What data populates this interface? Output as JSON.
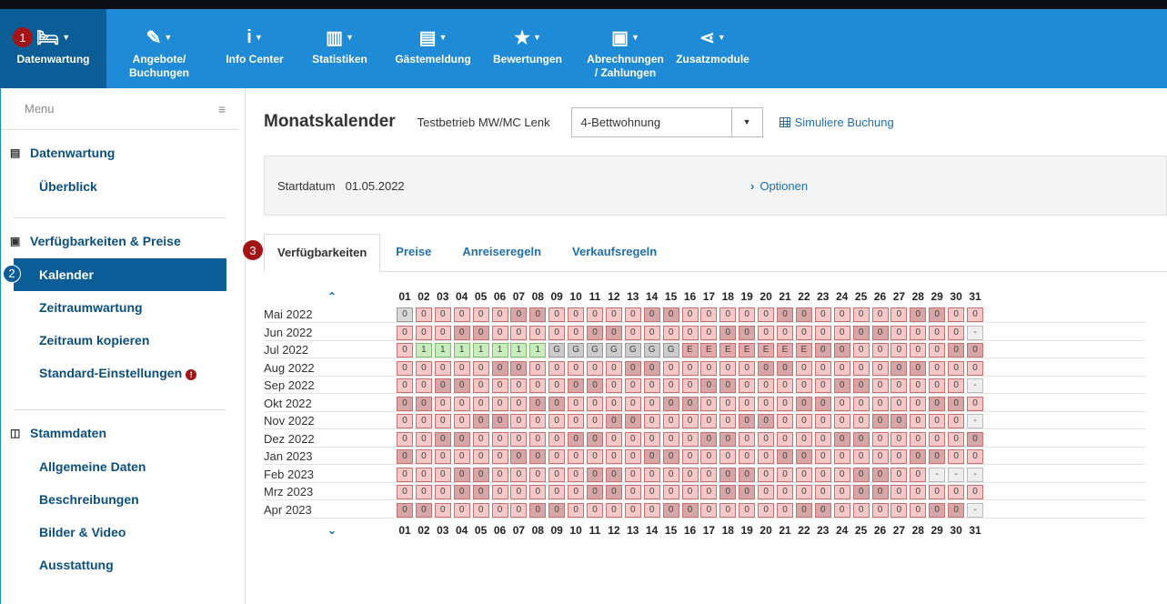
{
  "nav": {
    "items": [
      {
        "label": "Datenwartung",
        "icon": "bed-icon",
        "glyph": "🛏",
        "active": true
      },
      {
        "label": "Angebote/\nBuchungen",
        "icon": "offers-icon",
        "glyph": "✎",
        "active": false
      },
      {
        "label": "Info Center",
        "icon": "info-icon",
        "glyph": "i",
        "active": false
      },
      {
        "label": "Statistiken",
        "icon": "bar-chart-icon",
        "glyph": "▥",
        "active": false
      },
      {
        "label": "Gästemeldung",
        "icon": "document-icon",
        "glyph": "▤",
        "active": false
      },
      {
        "label": "Bewertungen",
        "icon": "star-icon",
        "glyph": "★",
        "active": false
      },
      {
        "label": "Abrechnungen\n/ Zahlungen",
        "icon": "money-icon",
        "glyph": "▣",
        "active": false
      },
      {
        "label": "Zusatzmodule",
        "icon": "share-icon",
        "glyph": "⋖",
        "active": false
      }
    ]
  },
  "badges": {
    "b1": "1",
    "b2": "2",
    "b3": "3"
  },
  "sidebar": {
    "menu_label": "Menu",
    "sections": [
      {
        "title": "Datenwartung",
        "icon": "document-icon",
        "items": [
          "Überblick"
        ]
      },
      {
        "title": "Verfügbarkeiten & Preise",
        "icon": "money-icon",
        "items": [
          "Kalender",
          "Zeitraumwartung",
          "Zeitraum kopieren",
          "Standard-Einstellungen"
        ]
      },
      {
        "title": "Stammdaten",
        "icon": "columns-icon",
        "items": [
          "Allgemeine Daten",
          "Beschreibungen",
          "Bilder & Video",
          "Ausstattung"
        ]
      }
    ],
    "warning_glyph": "!"
  },
  "main": {
    "title": "Monatskalender",
    "property": "Testbetrieb MW/MC Lenk",
    "unit_select": "4-Bettwohnung",
    "simulate_link": "Simuliere Buchung",
    "start_label": "Startdatum",
    "start_value": "01.05.2022",
    "options_link": "Optionen",
    "tabs": [
      "Verfügbarkeiten",
      "Preise",
      "Anreiseregeln",
      "Verkaufsregeln"
    ]
  },
  "calendar": {
    "days": [
      "01",
      "02",
      "03",
      "04",
      "05",
      "06",
      "07",
      "08",
      "09",
      "10",
      "11",
      "12",
      "13",
      "14",
      "15",
      "16",
      "17",
      "18",
      "19",
      "20",
      "21",
      "22",
      "23",
      "24",
      "25",
      "26",
      "27",
      "28",
      "29",
      "30",
      "31"
    ],
    "months": [
      {
        "label": "Mai 2022",
        "cells": [
          "0",
          "0",
          "0",
          "0",
          "0",
          "0",
          "0",
          "0",
          "0",
          "0",
          "0",
          "0",
          "0",
          "0",
          "0",
          "0",
          "0",
          "0",
          "0",
          "0",
          "0",
          "0",
          "0",
          "0",
          "0",
          "0",
          "0",
          "0",
          "0",
          "0",
          "0"
        ]
      },
      {
        "label": "Jun 2022",
        "cells": [
          "0",
          "0",
          "0",
          "0",
          "0",
          "0",
          "0",
          "0",
          "0",
          "0",
          "0",
          "0",
          "0",
          "0",
          "0",
          "0",
          "0",
          "0",
          "0",
          "0",
          "0",
          "0",
          "0",
          "0",
          "0",
          "0",
          "0",
          "0",
          "0",
          "0",
          "-"
        ]
      },
      {
        "label": "Jul 2022",
        "cells": [
          "0",
          "1",
          "1",
          "1",
          "1",
          "1",
          "1",
          "1",
          "G",
          "G",
          "G",
          "G",
          "G",
          "G",
          "G",
          "E",
          "E",
          "E",
          "E",
          "E",
          "E",
          "E",
          "0",
          "0",
          "0",
          "0",
          "0",
          "0",
          "0",
          "0",
          "0"
        ]
      },
      {
        "label": "Aug 2022",
        "cells": [
          "0",
          "0",
          "0",
          "0",
          "0",
          "0",
          "0",
          "0",
          "0",
          "0",
          "0",
          "0",
          "0",
          "0",
          "0",
          "0",
          "0",
          "0",
          "0",
          "0",
          "0",
          "0",
          "0",
          "0",
          "0",
          "0",
          "0",
          "0",
          "0",
          "0",
          "0"
        ]
      },
      {
        "label": "Sep 2022",
        "cells": [
          "0",
          "0",
          "0",
          "0",
          "0",
          "0",
          "0",
          "0",
          "0",
          "0",
          "0",
          "0",
          "0",
          "0",
          "0",
          "0",
          "0",
          "0",
          "0",
          "0",
          "0",
          "0",
          "0",
          "0",
          "0",
          "0",
          "0",
          "0",
          "0",
          "0",
          "-"
        ]
      },
      {
        "label": "Okt 2022",
        "cells": [
          "0",
          "0",
          "0",
          "0",
          "0",
          "0",
          "0",
          "0",
          "0",
          "0",
          "0",
          "0",
          "0",
          "0",
          "0",
          "0",
          "0",
          "0",
          "0",
          "0",
          "0",
          "0",
          "0",
          "0",
          "0",
          "0",
          "0",
          "0",
          "0",
          "0",
          "0"
        ]
      },
      {
        "label": "Nov 2022",
        "cells": [
          "0",
          "0",
          "0",
          "0",
          "0",
          "0",
          "0",
          "0",
          "0",
          "0",
          "0",
          "0",
          "0",
          "0",
          "0",
          "0",
          "0",
          "0",
          "0",
          "0",
          "0",
          "0",
          "0",
          "0",
          "0",
          "0",
          "0",
          "0",
          "0",
          "0",
          "-"
        ]
      },
      {
        "label": "Dez 2022",
        "cells": [
          "0",
          "0",
          "0",
          "0",
          "0",
          "0",
          "0",
          "0",
          "0",
          "0",
          "0",
          "0",
          "0",
          "0",
          "0",
          "0",
          "0",
          "0",
          "0",
          "0",
          "0",
          "0",
          "0",
          "0",
          "0",
          "0",
          "0",
          "0",
          "0",
          "0",
          "0"
        ]
      },
      {
        "label": "Jan 2023",
        "cells": [
          "0",
          "0",
          "0",
          "0",
          "0",
          "0",
          "0",
          "0",
          "0",
          "0",
          "0",
          "0",
          "0",
          "0",
          "0",
          "0",
          "0",
          "0",
          "0",
          "0",
          "0",
          "0",
          "0",
          "0",
          "0",
          "0",
          "0",
          "0",
          "0",
          "0",
          "0"
        ]
      },
      {
        "label": "Feb 2023",
        "cells": [
          "0",
          "0",
          "0",
          "0",
          "0",
          "0",
          "0",
          "0",
          "0",
          "0",
          "0",
          "0",
          "0",
          "0",
          "0",
          "0",
          "0",
          "0",
          "0",
          "0",
          "0",
          "0",
          "0",
          "0",
          "0",
          "0",
          "0",
          "0",
          "-",
          "-",
          "-"
        ]
      },
      {
        "label": "Mrz 2023",
        "cells": [
          "0",
          "0",
          "0",
          "0",
          "0",
          "0",
          "0",
          "0",
          "0",
          "0",
          "0",
          "0",
          "0",
          "0",
          "0",
          "0",
          "0",
          "0",
          "0",
          "0",
          "0",
          "0",
          "0",
          "0",
          "0",
          "0",
          "0",
          "0",
          "0",
          "0",
          "0"
        ]
      },
      {
        "label": "Apr 2023",
        "cells": [
          "0",
          "0",
          "0",
          "0",
          "0",
          "0",
          "0",
          "0",
          "0",
          "0",
          "0",
          "0",
          "0",
          "0",
          "0",
          "0",
          "0",
          "0",
          "0",
          "0",
          "0",
          "0",
          "0",
          "0",
          "0",
          "0",
          "0",
          "0",
          "0",
          "0",
          "-"
        ]
      }
    ],
    "first_weekday": [
      6,
      2,
      4,
      0,
      3,
      5,
      1,
      3,
      6,
      2,
      2,
      5
    ]
  },
  "colors": {
    "accent": "#1f8ad6",
    "active_nav": "#0b5d97",
    "badge": "#a51414"
  }
}
